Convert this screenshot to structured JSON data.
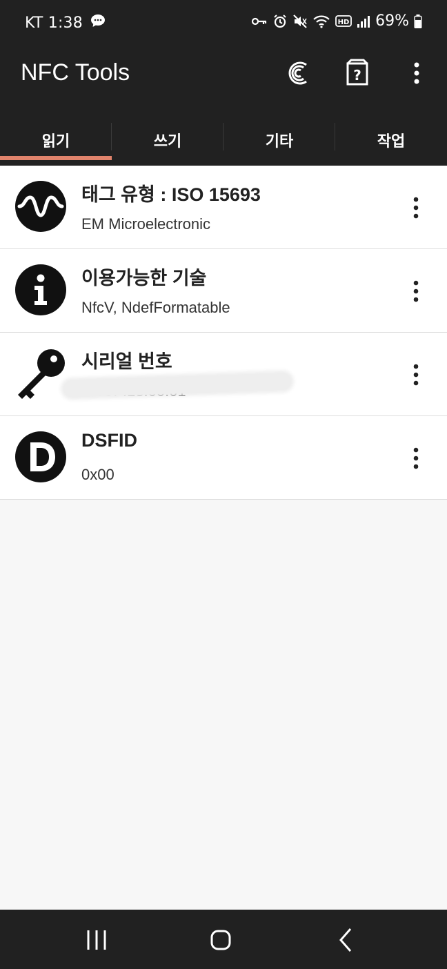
{
  "status_bar": {
    "carrier_time": "KT 1:38",
    "battery_percent": "69%",
    "battery_level": 0.69,
    "icons": [
      "chat-bubble-icon",
      "key-icon",
      "alarm-icon",
      "mute-icon",
      "wifi-icon",
      "hd-icon",
      "signal-icon",
      "battery-icon"
    ]
  },
  "app_bar": {
    "title": "NFC Tools",
    "actions": [
      "history-icon",
      "help-icon",
      "more-vert-icon"
    ]
  },
  "tabs": [
    {
      "label": "읽기",
      "active": true
    },
    {
      "label": "쓰기",
      "active": false
    },
    {
      "label": "기타",
      "active": false
    },
    {
      "label": "작업",
      "active": false
    }
  ],
  "records": [
    {
      "icon": "waveform-icon",
      "title": "태그 유형 : ISO 15693",
      "value": "EM Microelectronic"
    },
    {
      "icon": "info-icon",
      "title": "이용가능한 기술",
      "value": "NfcV, NdefFormatable"
    },
    {
      "icon": "key-icon",
      "title": "시리얼 번호",
      "value": "15:CF:18:00:01",
      "redacted": true
    },
    {
      "icon": "d-letter-icon",
      "title": "DSFID",
      "value": "0x00"
    }
  ],
  "nav_bar": {
    "buttons": [
      "recents-icon",
      "home-icon",
      "back-icon"
    ]
  },
  "colors": {
    "bar_bg": "#212121",
    "tab_indicator": "#e0836b",
    "list_bg": "#ffffff",
    "page_bg": "#f7f7f7"
  }
}
